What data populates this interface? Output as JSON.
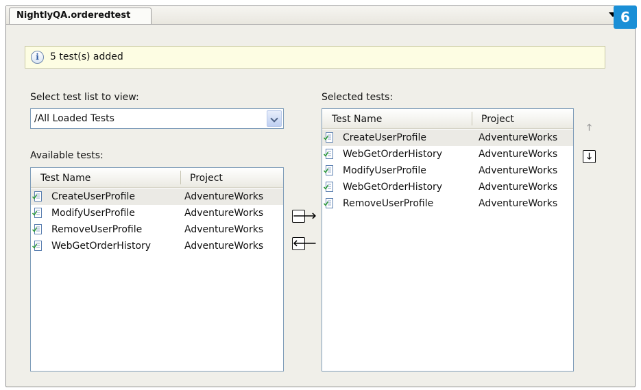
{
  "tab": {
    "title": "NightlyQA.orderedtest"
  },
  "badge": {
    "number": "6"
  },
  "info": {
    "message": "5 test(s) added",
    "icon": "info-icon"
  },
  "select_list": {
    "label": "Select test list to view:",
    "value": "/All Loaded Tests"
  },
  "available": {
    "label": "Available tests:",
    "col_name": "Test Name",
    "col_project": "Project",
    "rows": [
      {
        "name": "CreateUserProfile",
        "project": "AdventureWorks"
      },
      {
        "name": "ModifyUserProfile",
        "project": "AdventureWorks"
      },
      {
        "name": "RemoveUserProfile",
        "project": "AdventureWorks"
      },
      {
        "name": "WebGetOrderHistory",
        "project": "AdventureWorks"
      }
    ]
  },
  "selected": {
    "label": "Selected tests:",
    "col_name": "Test Name",
    "col_project": "Project",
    "rows": [
      {
        "name": "CreateUserProfile",
        "project": "AdventureWorks"
      },
      {
        "name": "WebGetOrderHistory",
        "project": "AdventureWorks"
      },
      {
        "name": "ModifyUserProfile",
        "project": "AdventureWorks"
      },
      {
        "name": "WebGetOrderHistory",
        "project": "AdventureWorks"
      },
      {
        "name": "RemoveUserProfile",
        "project": "AdventureWorks"
      }
    ]
  },
  "buttons": {
    "add": {
      "glyph": "🡒",
      "icon": "arrow-right-icon"
    },
    "remove": {
      "glyph": "🡐",
      "icon": "arrow-left-icon"
    },
    "move_up": {
      "glyph": "🡑",
      "icon": "arrow-up-icon"
    },
    "move_down": {
      "glyph": "🡓",
      "icon": "arrow-down-icon"
    }
  },
  "colors": {
    "badge": "#1a8fd6",
    "info_bg": "#fdfde3",
    "panel_bg": "#f0efe9",
    "row_highlight": "#ebeae5"
  }
}
